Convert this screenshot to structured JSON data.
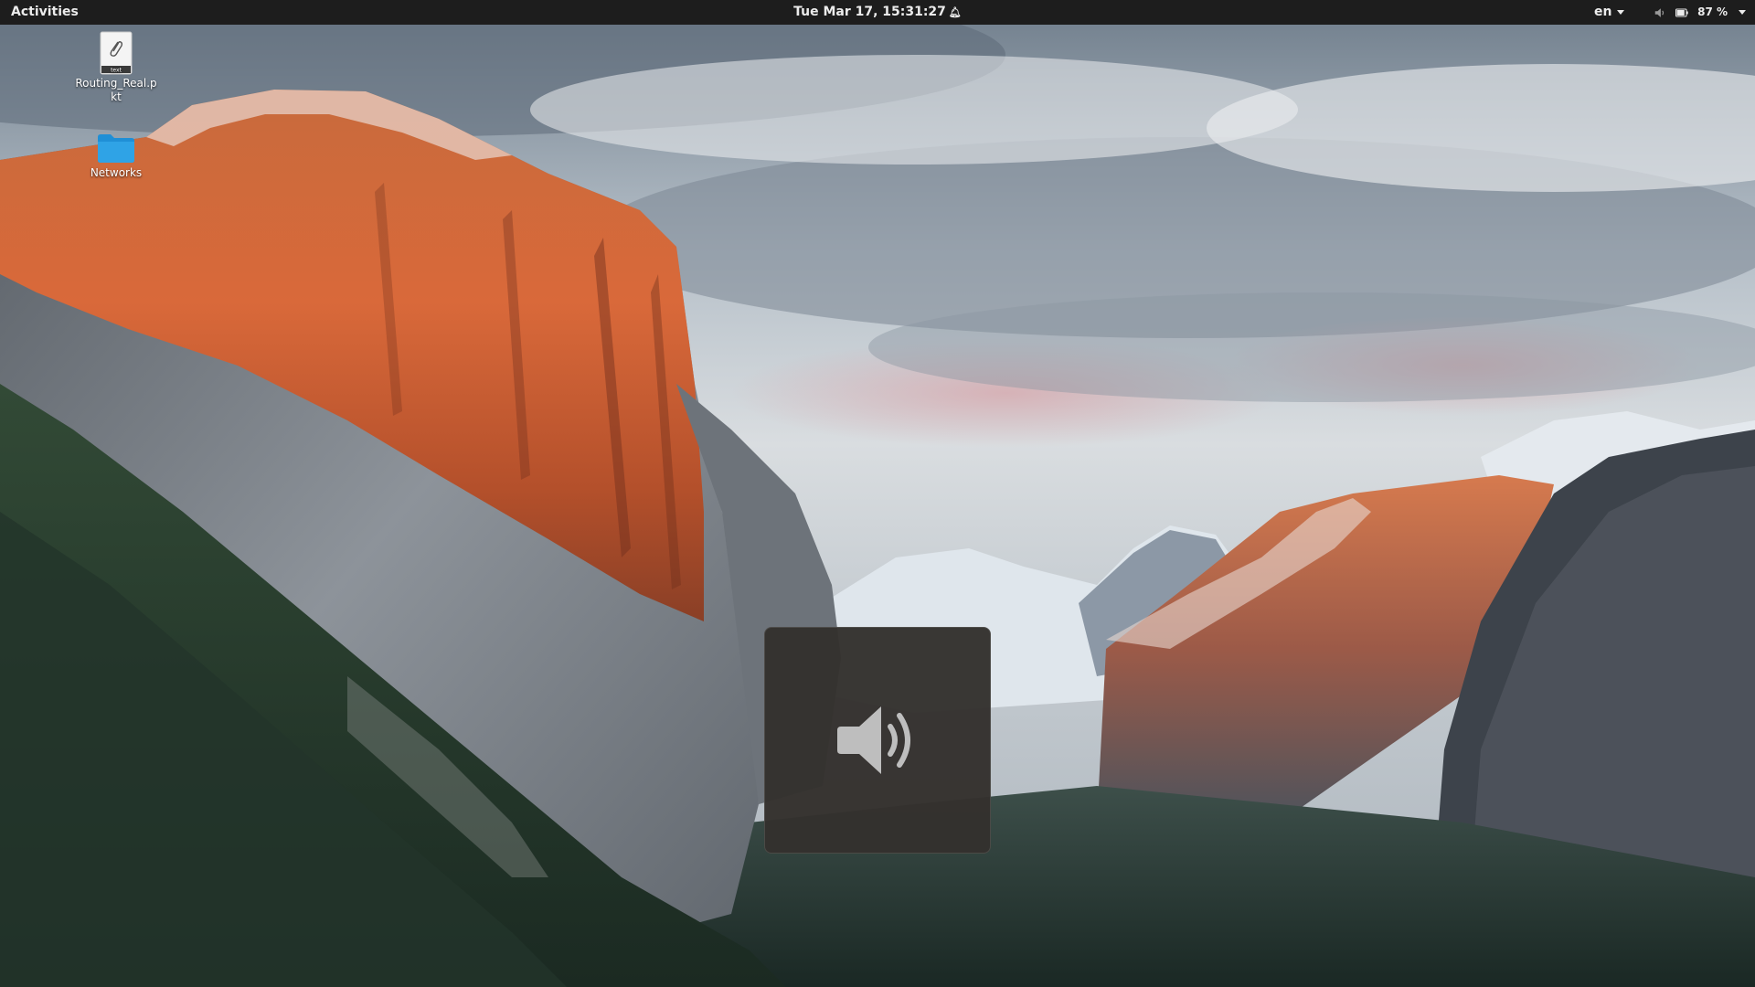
{
  "topbar": {
    "activities_label": "Activities",
    "clock_text": "Tue Mar 17, 15:31:27",
    "notification_icon": "bell-icon",
    "input_source": "en",
    "volume_icon": "speaker-icon",
    "battery_icon": "battery-icon",
    "battery_level": 87,
    "battery_text": "87 %"
  },
  "desktop_icons": [
    {
      "label": "Routing_Real.pkt",
      "icon": "text-file-icon",
      "badge": "text"
    },
    {
      "label": "Networks",
      "icon": "folder-icon"
    }
  ],
  "osd": {
    "icon": "audio-volume-icon"
  },
  "colors": {
    "topbar_bg": "#1d1d1d",
    "topbar_text": "#ececec",
    "osd_bg": "#34312d",
    "osd_icon": "#bebebe",
    "folder_blue": "#2fa3e6"
  }
}
